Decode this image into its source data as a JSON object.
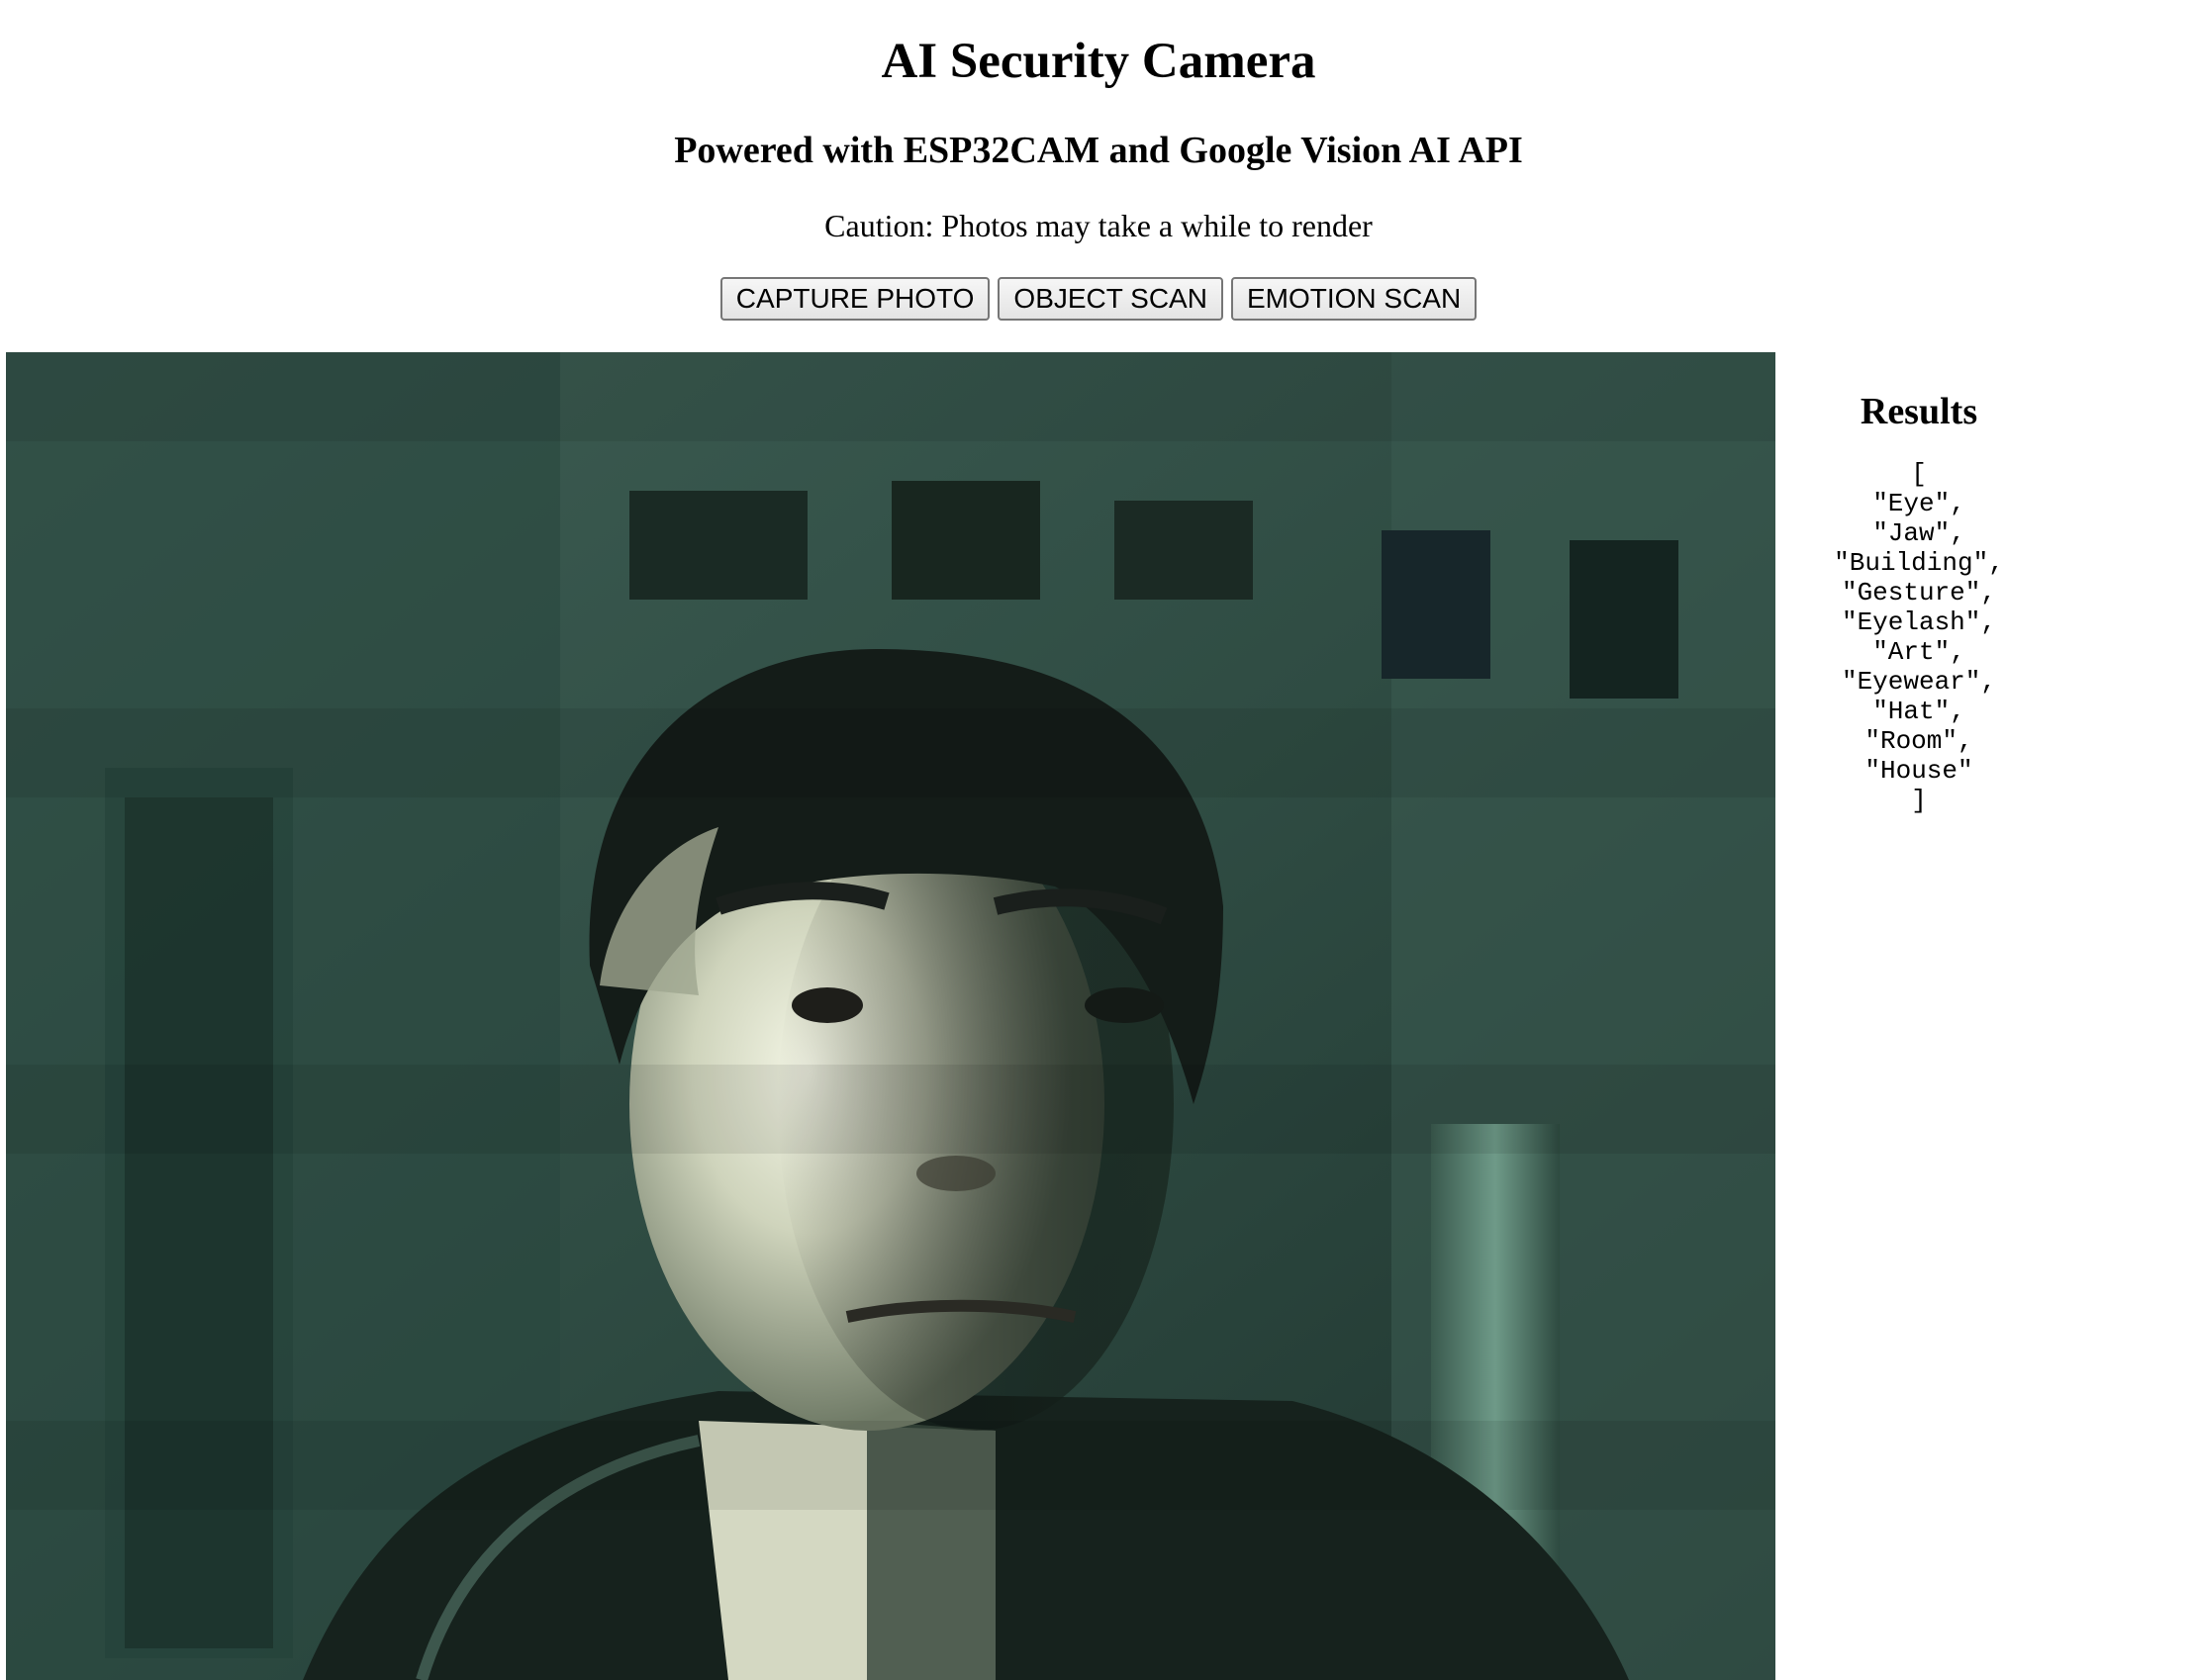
{
  "header": {
    "title": "AI Security Camera",
    "subtitle": "Powered with ESP32CAM and Google Vision AI API",
    "caution": "Caution: Photos may take a while to render"
  },
  "buttons": {
    "capture": "CAPTURE PHOTO",
    "object_scan": "OBJECT SCAN",
    "emotion_scan": "EMOTION SCAN"
  },
  "feed": {
    "icon": "camera-photo"
  },
  "results": {
    "heading": "Results",
    "open_bracket": "[",
    "labels": [
      "Eye",
      "Jaw",
      "Building",
      "Gesture",
      "Eyelash",
      "Art",
      "Eyewear",
      "Hat",
      "Room",
      "House"
    ],
    "close_bracket": "]"
  }
}
